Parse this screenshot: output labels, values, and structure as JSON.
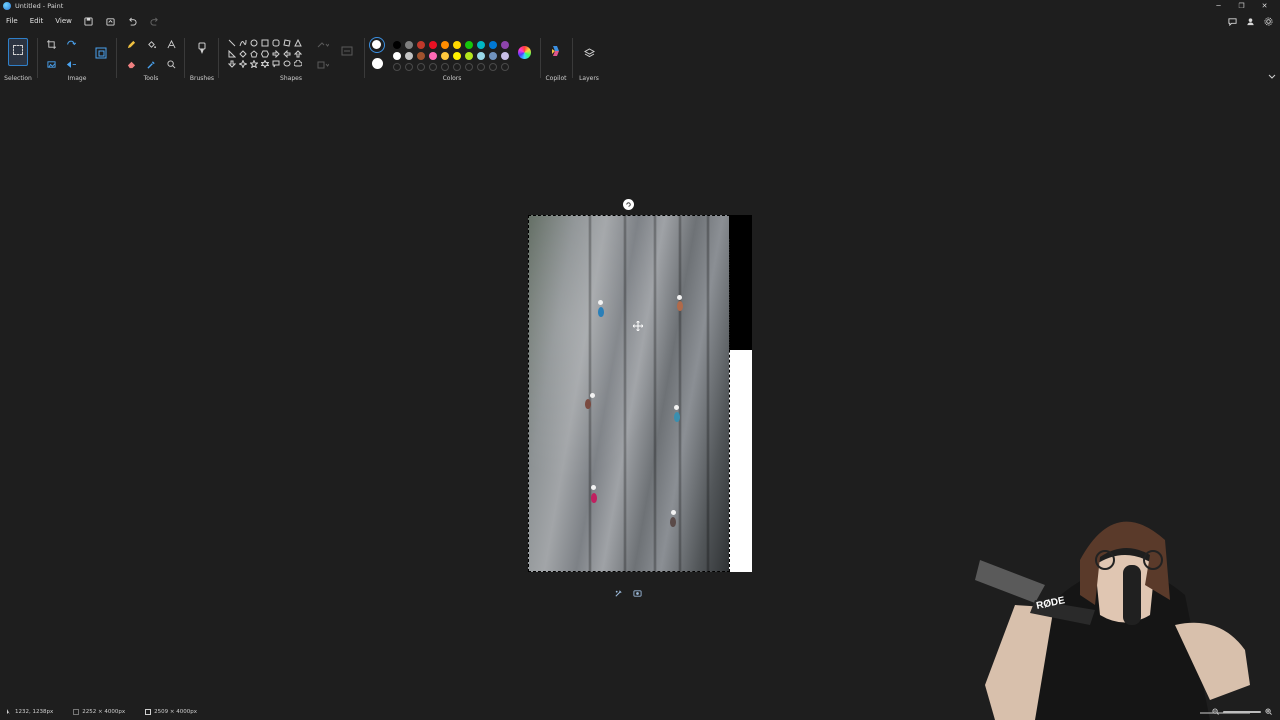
{
  "window": {
    "title": "Untitled - Paint",
    "controls": [
      "minimize-icon",
      "restore-icon",
      "close-icon"
    ]
  },
  "menu": {
    "items": [
      "File",
      "Edit",
      "View"
    ],
    "quick_access": [
      "save-icon",
      "share-icon",
      "undo-icon",
      "redo-icon"
    ],
    "right_icons": [
      "share-icon",
      "account-icon",
      "settings-icon"
    ]
  },
  "ribbon": {
    "groups": {
      "selection": "Selection",
      "image": "Image",
      "tools": "Tools",
      "brushes": "Brushes",
      "shapes": "Shapes",
      "colors": "Colors",
      "copilot": "Copilot",
      "layers": "Layers"
    },
    "colors": {
      "primary": "#ffffff",
      "secondary": "#ffffff",
      "palette_row1": [
        "#000000",
        "#7f7f7f",
        "#c0392b",
        "#e81123",
        "#ff8c00",
        "#ffd700",
        "#16c60c",
        "#00b7c3",
        "#0078d4",
        "#8e44ad"
      ],
      "palette_row2": [
        "#ffffff",
        "#c3c3c3",
        "#a0522d",
        "#ff69b4",
        "#ffc83d",
        "#fff100",
        "#b5e61d",
        "#99d9ea",
        "#7092be",
        "#c8bfe7"
      ]
    }
  },
  "canvas": {
    "selection_toolbar_icons": [
      "ai-edit-icon",
      "remove-background-icon"
    ]
  },
  "status": {
    "cursor_position": "1232, 1238px",
    "selection_size": "2252 × 4000px",
    "canvas_size": "2509 × 4000px"
  }
}
